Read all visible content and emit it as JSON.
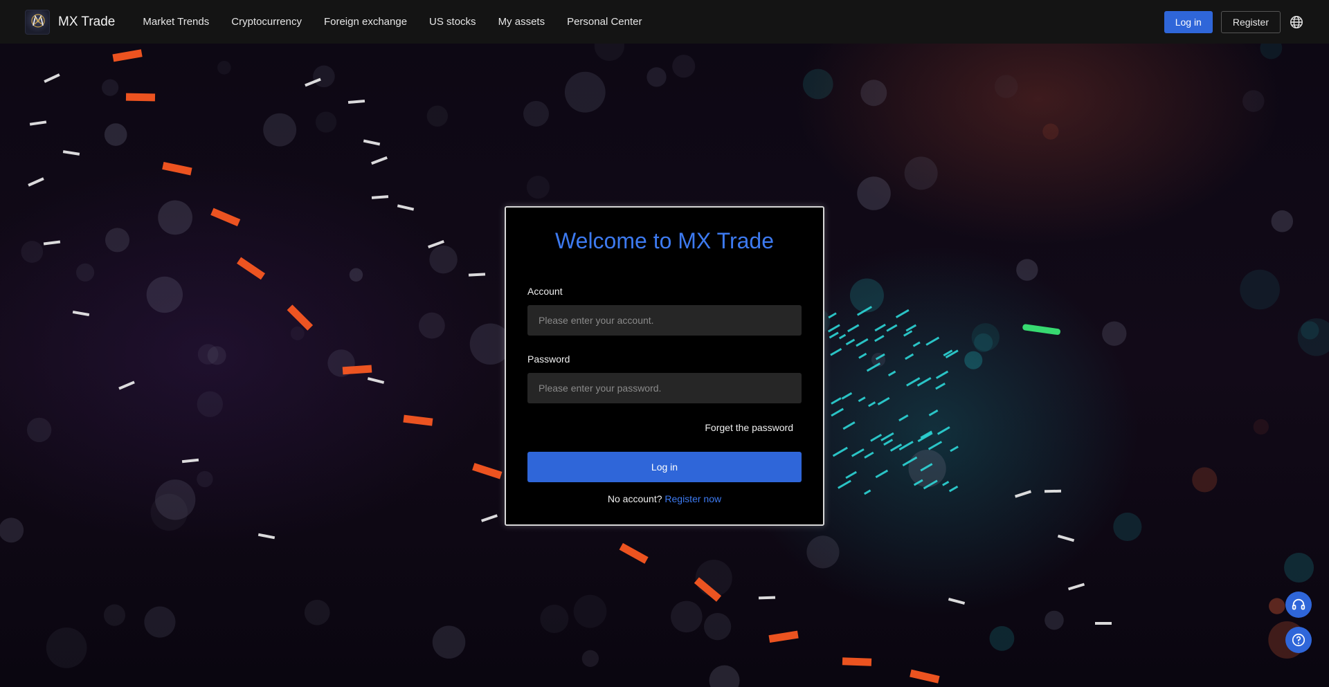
{
  "header": {
    "brand": "MX Trade",
    "logo_text": "MX Trade",
    "nav": [
      {
        "label": "Market Trends"
      },
      {
        "label": "Cryptocurrency"
      },
      {
        "label": "Foreign exchange"
      },
      {
        "label": "US stocks"
      },
      {
        "label": "My assets"
      },
      {
        "label": "Personal Center"
      }
    ],
    "login_label": "Log in",
    "register_label": "Register",
    "language_icon": "globe-icon"
  },
  "login": {
    "title": "Welcome to MX Trade",
    "account_label": "Account",
    "account_placeholder": "Please enter your account.",
    "account_value": "",
    "password_label": "Password",
    "password_placeholder": "Please enter your password.",
    "password_value": "",
    "forget_label": "Forget the password",
    "submit_label": "Log in",
    "no_account_text": "No account?",
    "register_link": "Register now"
  },
  "floating": {
    "support_icon": "headset-icon",
    "help_icon": "question-circle-icon"
  },
  "colors": {
    "accent": "#2f66d9",
    "title": "#3d7af0",
    "header_bg": "#141414",
    "card_bg": "#000000"
  }
}
